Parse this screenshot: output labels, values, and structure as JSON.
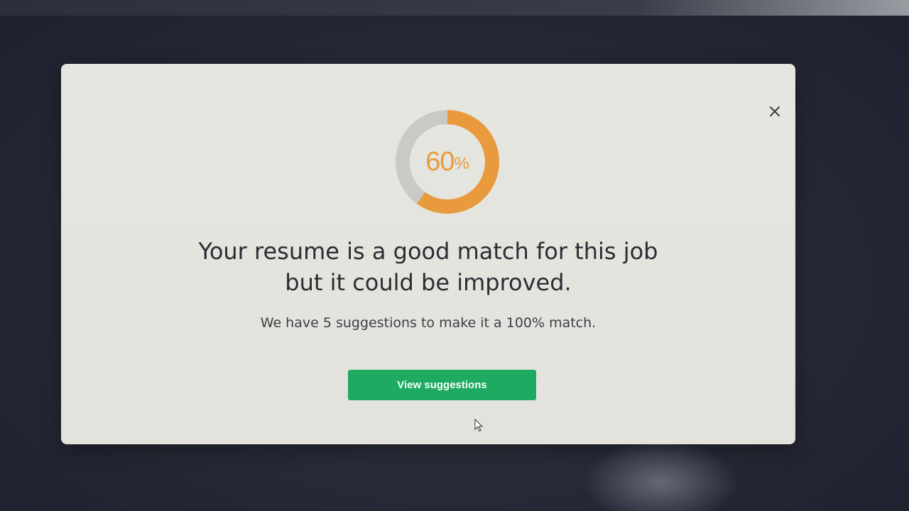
{
  "modal": {
    "score": {
      "value": "60",
      "unit": "%",
      "percent": 60,
      "colors": {
        "filled": "#e89a3c",
        "track": "#c9cac6"
      }
    },
    "headline_line1": "Your resume is a good match for this job",
    "headline_line2": "but it could be improved.",
    "subtext": "We have 5 suggestions to make it a 100% match.",
    "cta_label": "View suggestions",
    "cta_color": "#1faa62",
    "close_icon": "close-icon"
  },
  "colors": {
    "modal_bg": "#e5e4de",
    "page_bg": "#2a2d3a",
    "text": "#2b2d33"
  }
}
